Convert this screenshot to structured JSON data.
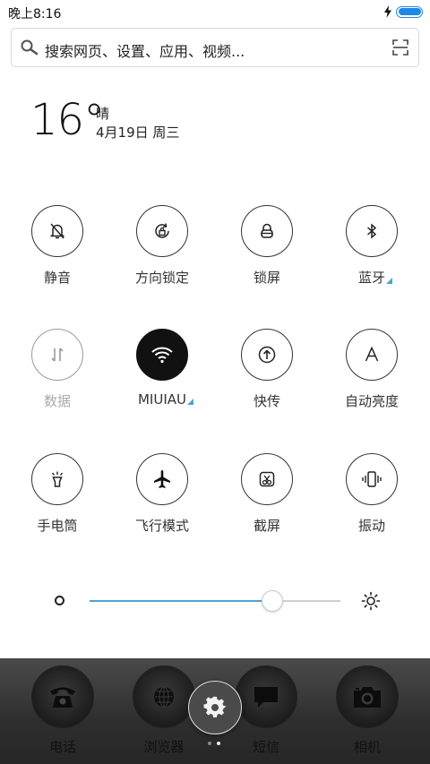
{
  "status_bar": {
    "time": "晚上8:16",
    "battery_level": 1.0,
    "accent": "#1e88e5"
  },
  "search": {
    "placeholder": "搜索网页、设置、应用、视频..."
  },
  "weather": {
    "temperature": "16°",
    "condition": "晴",
    "date": "4月19日 周三"
  },
  "toggles": [
    {
      "label": "静音",
      "icon": "bell-off-icon",
      "state": "off"
    },
    {
      "label": "方向锁定",
      "icon": "rotation-lock-icon",
      "state": "off"
    },
    {
      "label": "锁屏",
      "icon": "lock-icon",
      "state": "off"
    },
    {
      "label": "蓝牙",
      "icon": "bluetooth-icon",
      "state": "off",
      "has_more": true
    },
    {
      "label": "数据",
      "icon": "mobile-data-icon",
      "state": "disabled"
    },
    {
      "label": "MIUIAU",
      "icon": "wifi-icon",
      "state": "on",
      "has_more": true
    },
    {
      "label": "快传",
      "icon": "quick-transfer-icon",
      "state": "off"
    },
    {
      "label": "自动亮度",
      "icon": "auto-brightness-icon",
      "state": "off"
    },
    {
      "label": "手电筒",
      "icon": "flashlight-icon",
      "state": "off"
    },
    {
      "label": "飞行模式",
      "icon": "airplane-icon",
      "state": "off"
    },
    {
      "label": "截屏",
      "icon": "screenshot-icon",
      "state": "off"
    },
    {
      "label": "振动",
      "icon": "vibrate-icon",
      "state": "off"
    }
  ],
  "brightness": {
    "level": 0.73,
    "accent": "#4ba6c8"
  },
  "dock": {
    "apps": [
      {
        "label": "电话",
        "icon": "phone-icon"
      },
      {
        "label": "浏览器",
        "icon": "browser-icon"
      },
      {
        "label": "短信",
        "icon": "message-icon"
      },
      {
        "label": "相机",
        "icon": "camera-icon"
      }
    ],
    "page_count": 2,
    "current_page": 2
  }
}
